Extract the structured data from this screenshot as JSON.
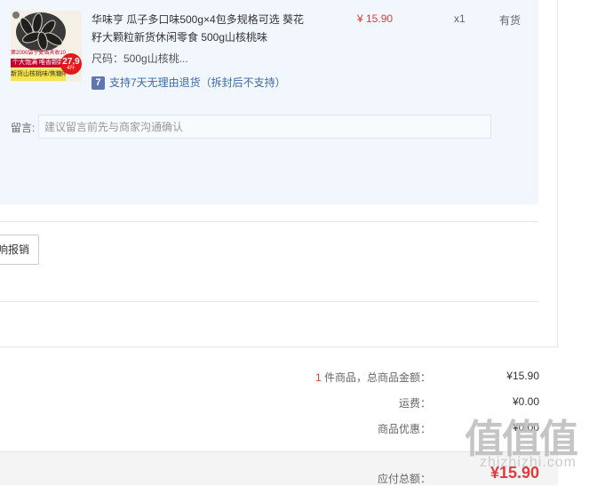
{
  "item": {
    "thumbnail": {
      "top_text": "第2000袋宁夏当天收10.9",
      "badge_top": "个大饱满 唯香颗颗",
      "badge_bottom": "新货山核桃味/焦糖味",
      "price": "27.9",
      "price_unit": "4斤"
    },
    "name": "华味亨 瓜子多口味500g×4包多规格可选 葵花籽大颗粒新货休闲零食 500g山核桃味",
    "spec": "尺码：500g山核桃...",
    "return_icon_text": "7",
    "return_policy": "支持7天无理由退货（拆封后不支持）",
    "unit_price": "¥ 15.90",
    "quantity": "x1",
    "stock": "有货"
  },
  "remark": {
    "label": "留言:",
    "placeholder": "建议留言前先与商家沟通确认"
  },
  "invoice": {
    "button_label": "响报销"
  },
  "summary": {
    "count": "1",
    "count_suffix": " 件商品，总商品金额：",
    "goods_total": "¥15.90",
    "shipping_label": "运费：",
    "shipping": "¥0.00",
    "discount_label": "商品优惠：",
    "discount": "¥0.00",
    "payable_label": "应付总额：",
    "payable": "¥15.90"
  },
  "watermark": {
    "glyphs": "值值值",
    "domain": "zhizhizhi.com"
  },
  "colors": {
    "price_red": "#e4393c",
    "panel_bg": "#f1f7fd",
    "link_blue": "#3b6aa8"
  }
}
